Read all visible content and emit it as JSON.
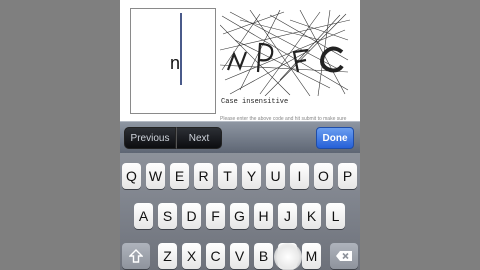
{
  "captcha": {
    "answer_text": "n",
    "image_text": "NPFC",
    "case_note": "Case insensitive",
    "instructions": "Please enter the above code and hit submit to make sure you're human."
  },
  "toolbar": {
    "previous_label": "Previous",
    "next_label": "Next",
    "done_label": "Done"
  },
  "keyboard": {
    "row1": [
      "Q",
      "W",
      "E",
      "R",
      "T",
      "Y",
      "U",
      "I",
      "O",
      "P"
    ],
    "row2": [
      "A",
      "S",
      "D",
      "F",
      "G",
      "H",
      "J",
      "K",
      "L"
    ],
    "row3": [
      "Z",
      "X",
      "C",
      "V",
      "B",
      "N",
      "M"
    ],
    "shift_icon": "shift-arrow-icon",
    "backspace_icon": "backspace-icon"
  },
  "colors": {
    "done_button": "#2f6ad8",
    "toolbar": "#707886",
    "keyboard_bg": "#7d828b"
  }
}
